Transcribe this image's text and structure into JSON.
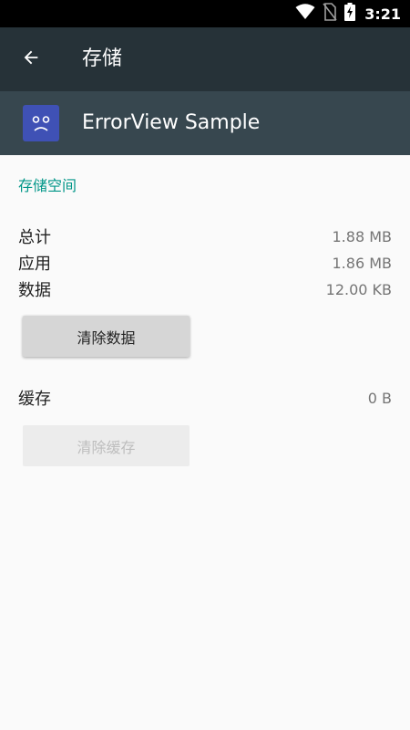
{
  "status_bar": {
    "time": "3:21",
    "icons": [
      "wifi-icon",
      "no-sim-icon",
      "battery-charging-icon"
    ]
  },
  "toolbar": {
    "title": "存储",
    "back_icon": "arrow-back-icon"
  },
  "app": {
    "name": "ErrorView Sample",
    "icon": "sad-face-icon",
    "icon_color": "#3f51b5"
  },
  "storage": {
    "section_title": "存储空间",
    "rows": [
      {
        "label": "总计",
        "value": "1.88 MB"
      },
      {
        "label": "应用",
        "value": "1.86 MB"
      },
      {
        "label": "数据",
        "value": "12.00 KB"
      }
    ],
    "clear_data_label": "清除数据"
  },
  "cache": {
    "label": "缓存",
    "value": "0 B",
    "clear_cache_label": "清除缓存"
  },
  "colors": {
    "toolbar": "#263238",
    "app_header": "#37474f",
    "accent": "#009688"
  }
}
